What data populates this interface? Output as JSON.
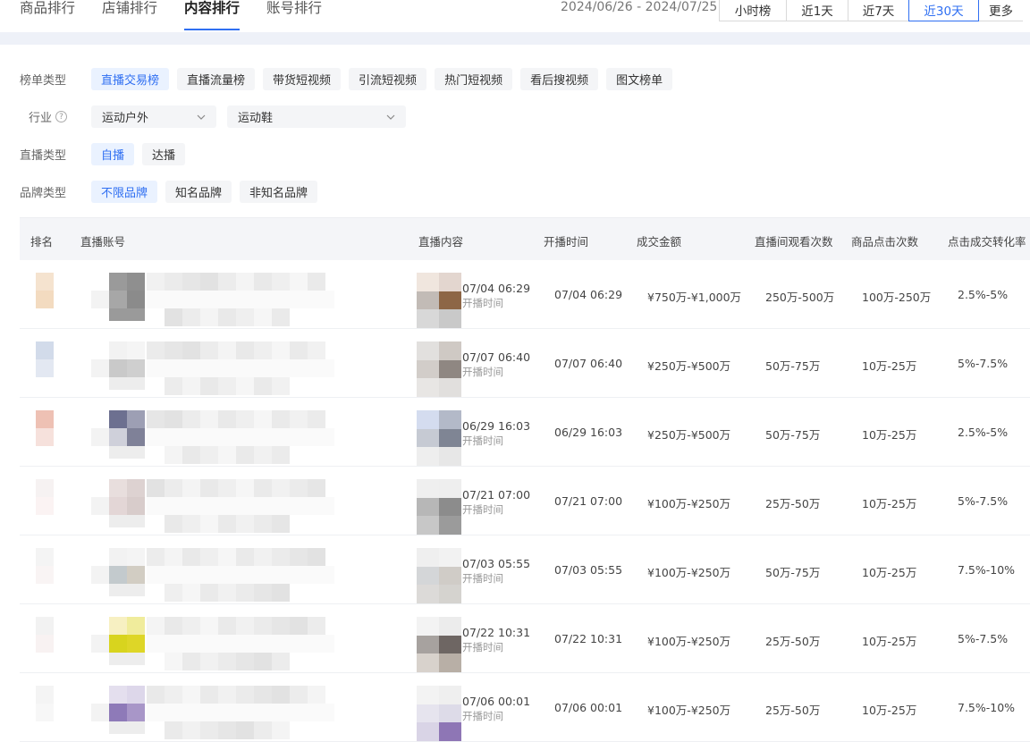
{
  "tabs": [
    "商品排行",
    "店铺排行",
    "内容排行",
    "账号排行"
  ],
  "active_tab": 2,
  "date_range": "2024/06/26 - 2024/07/25",
  "range_buttons": [
    "小时榜",
    "近1天",
    "近7天",
    "近30天",
    "更多"
  ],
  "filters": {
    "list_type": {
      "label": "榜单类型",
      "options": [
        "直播交易榜",
        "直播流量榜",
        "带货短视频",
        "引流短视频",
        "热门短视频",
        "看后搜视频",
        "图文榜单"
      ]
    },
    "industry": {
      "label": "行业",
      "help": "?",
      "select1": "运动户外",
      "select2": "运动鞋"
    },
    "live_type": {
      "label": "直播类型",
      "options": [
        "自播",
        "达播"
      ]
    },
    "brand_type": {
      "label": "品牌类型",
      "options": [
        "不限品牌",
        "知名品牌",
        "非知名品牌"
      ]
    }
  },
  "table": {
    "headers": [
      "排名",
      "直播账号",
      "直播内容",
      "开播时间",
      "成交金额",
      "直播间观看次数",
      "商品点击次数",
      "点击成交转化率"
    ],
    "content_sub": "开播时间",
    "rows": [
      {
        "content_time": "07/04 06:29",
        "start": "07/04 06:29",
        "amount": "¥750万-¥1,000万",
        "views": "250万-500万",
        "clicks": "100万-250万",
        "rate": "2.5%-5%"
      },
      {
        "content_time": "07/07 06:40",
        "start": "07/07 06:40",
        "amount": "¥250万-¥500万",
        "views": "50万-75万",
        "clicks": "10万-25万",
        "rate": "5%-7.5%"
      },
      {
        "content_time": "06/29 16:03",
        "start": "06/29 16:03",
        "amount": "¥250万-¥500万",
        "views": "50万-75万",
        "clicks": "10万-25万",
        "rate": "2.5%-5%"
      },
      {
        "content_time": "07/21 07:00",
        "start": "07/21 07:00",
        "amount": "¥100万-¥250万",
        "views": "25万-50万",
        "clicks": "10万-25万",
        "rate": "5%-7.5%"
      },
      {
        "content_time": "07/03 05:55",
        "start": "07/03 05:55",
        "amount": "¥100万-¥250万",
        "views": "50万-75万",
        "clicks": "10万-25万",
        "rate": "7.5%-10%"
      },
      {
        "content_time": "07/22 10:31",
        "start": "07/22 10:31",
        "amount": "¥100万-¥250万",
        "views": "25万-50万",
        "clicks": "10万-25万",
        "rate": "5%-7.5%"
      },
      {
        "content_time": "07/06 00:01",
        "start": "07/06 00:01",
        "amount": "¥100万-¥250万",
        "views": "25万-50万",
        "clicks": "10万-25万",
        "rate": "7.5%-10%"
      }
    ]
  },
  "colors": {
    "accent": "#2f6ff2",
    "chip_bg": "#f4f5f7",
    "chip_active_bg": "#eaf2ff"
  }
}
